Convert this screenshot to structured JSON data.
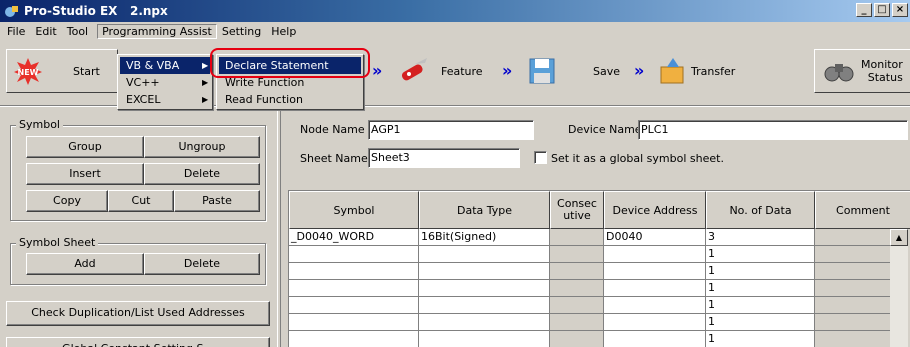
{
  "window": {
    "title": "Pro-Studio EX   2.npx",
    "controls": [
      "_",
      "□",
      "×"
    ]
  },
  "menubar": [
    "File",
    "Edit",
    "Tool",
    "Programming Assist",
    "Setting",
    "Help"
  ],
  "toolbar": {
    "start": "Start",
    "feature": "Feature",
    "save": "Save",
    "transfer": "Transfer",
    "monitor": "Monitor",
    "status": "Status",
    "arrow": "»"
  },
  "menus": {
    "programming_assist": [
      "VB & VBA",
      "VC++",
      "EXCEL"
    ],
    "vb_vba": [
      "Declare Statement",
      "Write Function",
      "Read Function"
    ]
  },
  "symbol_group": {
    "title": "Symbol",
    "buttons": [
      "Group",
      "Ungroup",
      "Insert",
      "Delete",
      "Copy",
      "Cut",
      "Paste"
    ]
  },
  "symbol_sheet_group": {
    "title": "Symbol Sheet",
    "buttons": [
      "Add",
      "Delete"
    ]
  },
  "check_button": "Check Duplication/List Used Addresses",
  "bottom_button": "Global Constant Setting S...",
  "form": {
    "node_name_label": "Node Name",
    "node_name_value": "AGP1",
    "device_name_label": "Device Name",
    "device_name_value": "PLC1",
    "sheet_name_label": "Sheet Name",
    "sheet_name_value": "Sheet3",
    "global_checkbox_label": "Set it as a global symbol sheet."
  },
  "grid": {
    "columns": [
      "Symbol",
      "Data Type",
      "Consec utive",
      "Device Address",
      "No. of Data",
      "Comment"
    ],
    "rows": [
      [
        "_D0040_WORD",
        "16Bit(Signed)",
        "",
        "D0040",
        "3",
        ""
      ],
      [
        "",
        "",
        "",
        "",
        "1",
        ""
      ],
      [
        "",
        "",
        "",
        "",
        "1",
        ""
      ],
      [
        "",
        "",
        "",
        "",
        "1",
        ""
      ],
      [
        "",
        "",
        "",
        "",
        "1",
        ""
      ],
      [
        "",
        "",
        "",
        "",
        "1",
        ""
      ],
      [
        "",
        "",
        "",
        "",
        "1",
        ""
      ]
    ]
  },
  "colors": {
    "highlight_ring": "#e60012",
    "selection": "#0a246a",
    "arrow": "#0000cc"
  }
}
